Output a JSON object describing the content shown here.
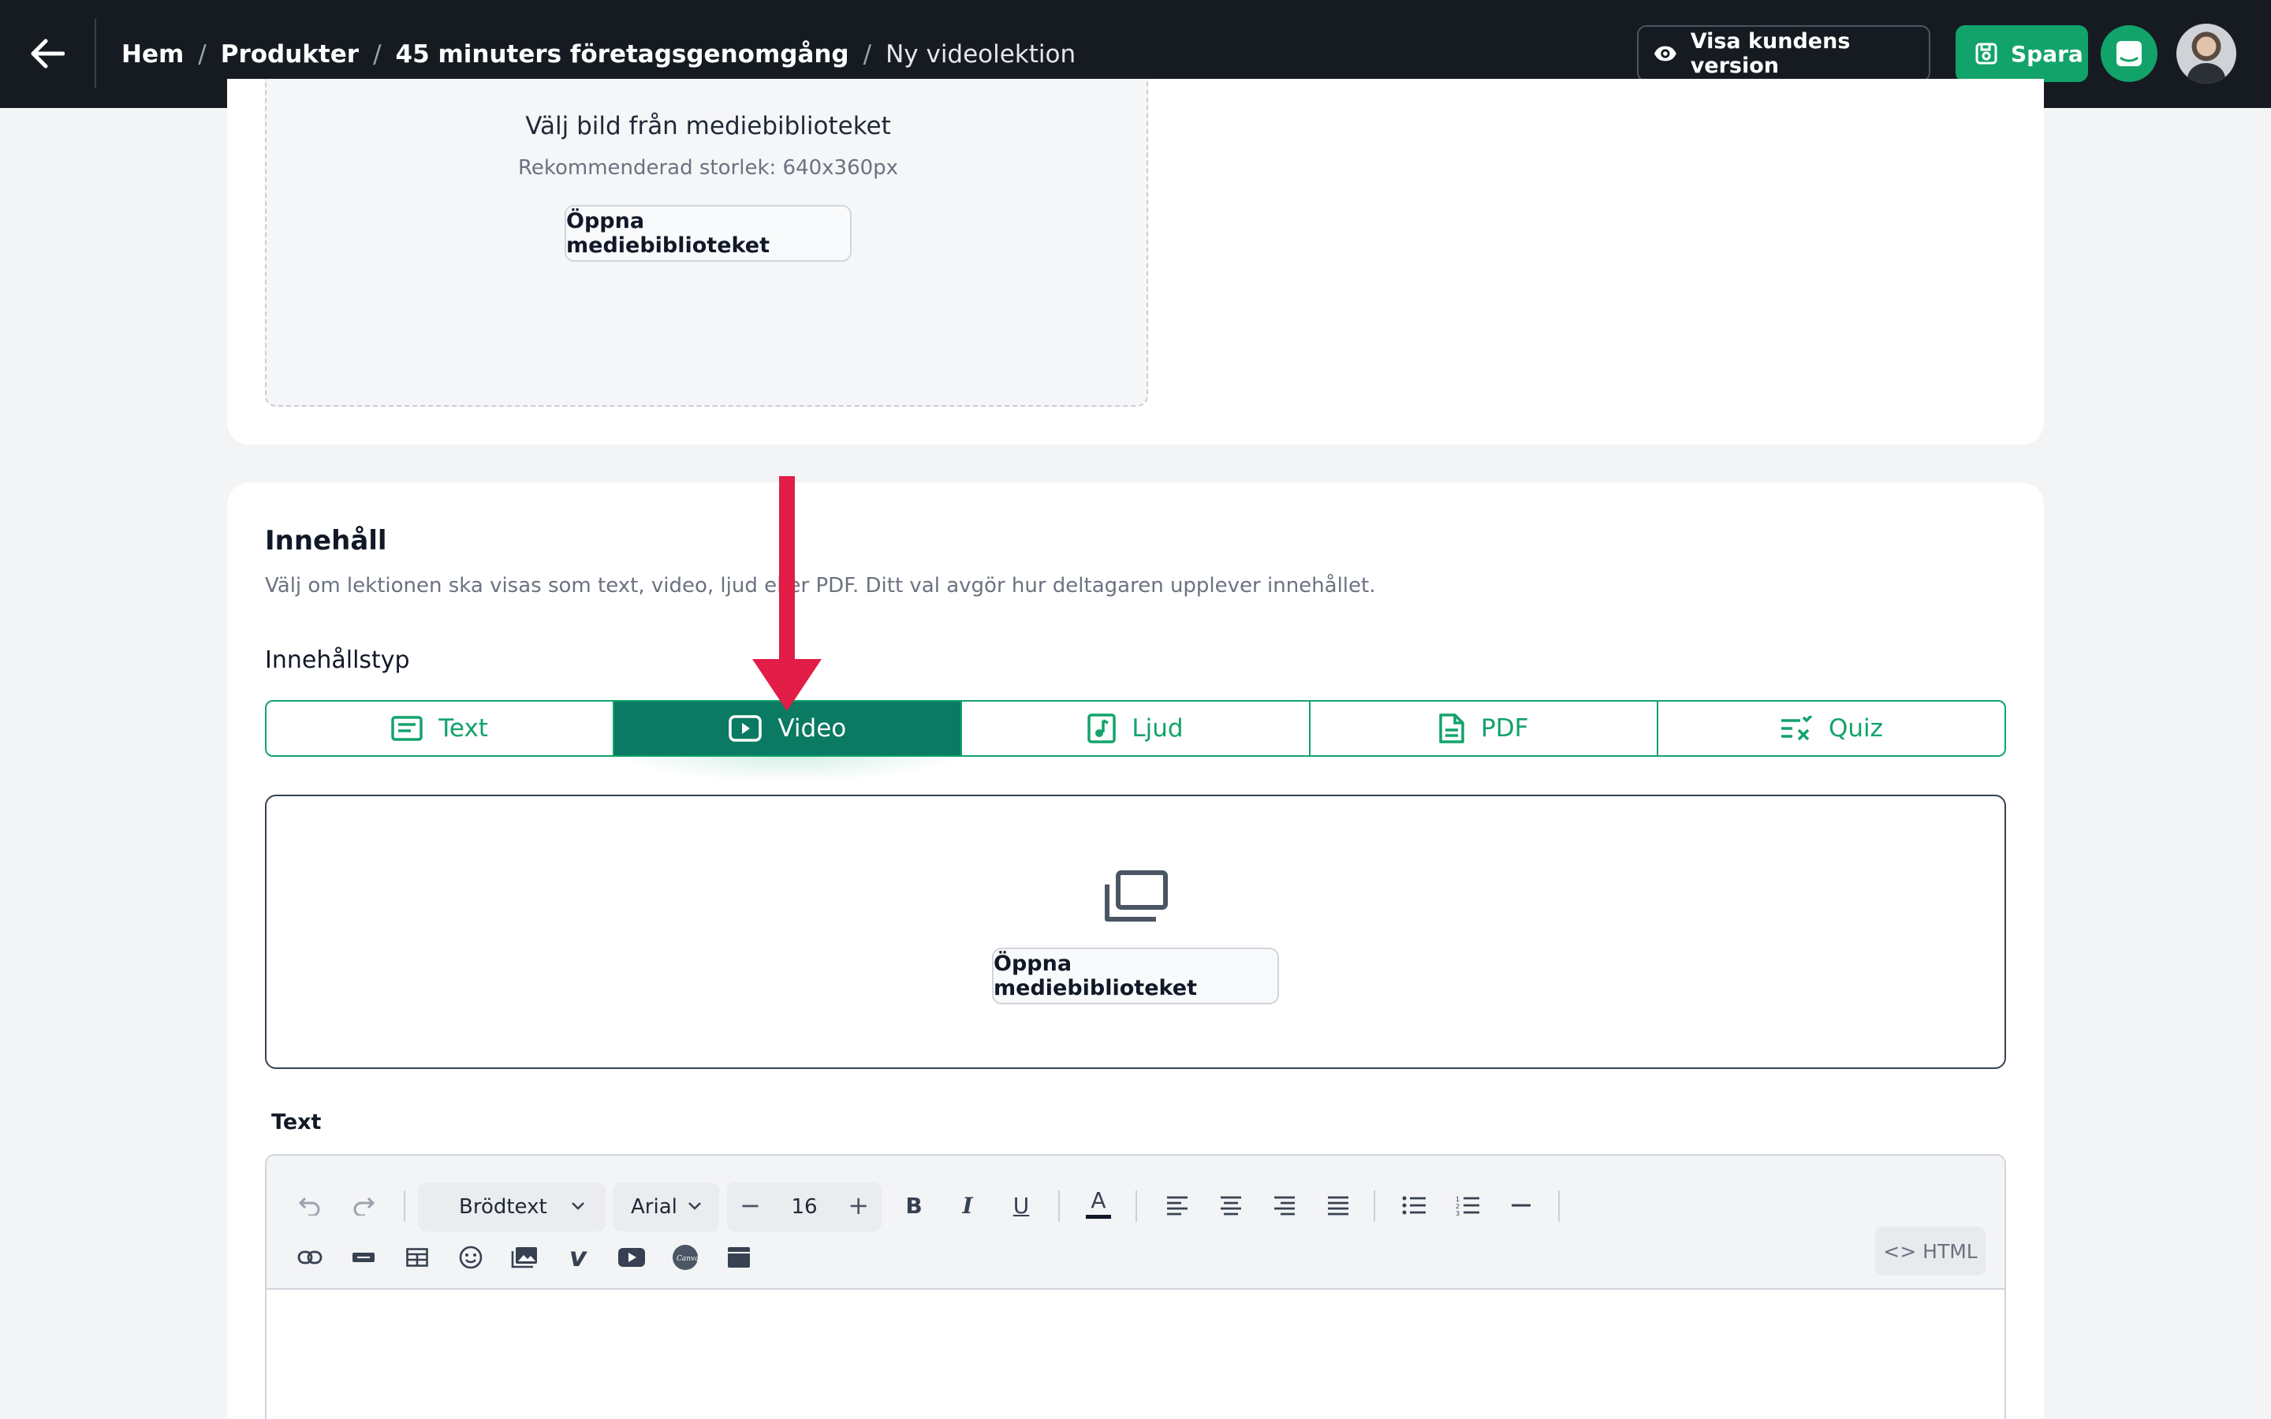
{
  "header": {
    "breadcrumbs": [
      "Hem",
      "Produkter",
      "45 minuters företagsgenomgång",
      "Ny videolektion"
    ],
    "separator": "/",
    "view_customer_label": "Visa kundens version",
    "save_label": "Spara"
  },
  "image_section": {
    "title": "Välj bild från mediebiblioteket",
    "subtitle": "Rekommenderad storlek: 640x360px",
    "open_library_label": "Öppna mediebiblioteket"
  },
  "content_section": {
    "title": "Innehåll",
    "description": "Välj om lektionen ska visas som text, video, ljud eller PDF. Ditt val avgör hur deltagaren upplever innehållet.",
    "type_label": "Innehållstyp",
    "tabs": [
      {
        "label": "Text",
        "icon": "text-icon",
        "active": false
      },
      {
        "label": "Video",
        "icon": "video-icon",
        "active": true
      },
      {
        "label": "Ljud",
        "icon": "audio-icon",
        "active": false
      },
      {
        "label": "PDF",
        "icon": "pdf-icon",
        "active": false
      },
      {
        "label": "Quiz",
        "icon": "quiz-icon",
        "active": false
      }
    ],
    "media_open_label": "Öppna mediebiblioteket",
    "text_label": "Text"
  },
  "editor": {
    "block_format": "Brödtext",
    "font_family": "Arial",
    "font_size": "16",
    "html_label": "HTML"
  },
  "colors": {
    "topbar": "#161b22",
    "accent": "#12a36b",
    "active_tab": "#0a7a62",
    "arrow": "#e11d48"
  }
}
